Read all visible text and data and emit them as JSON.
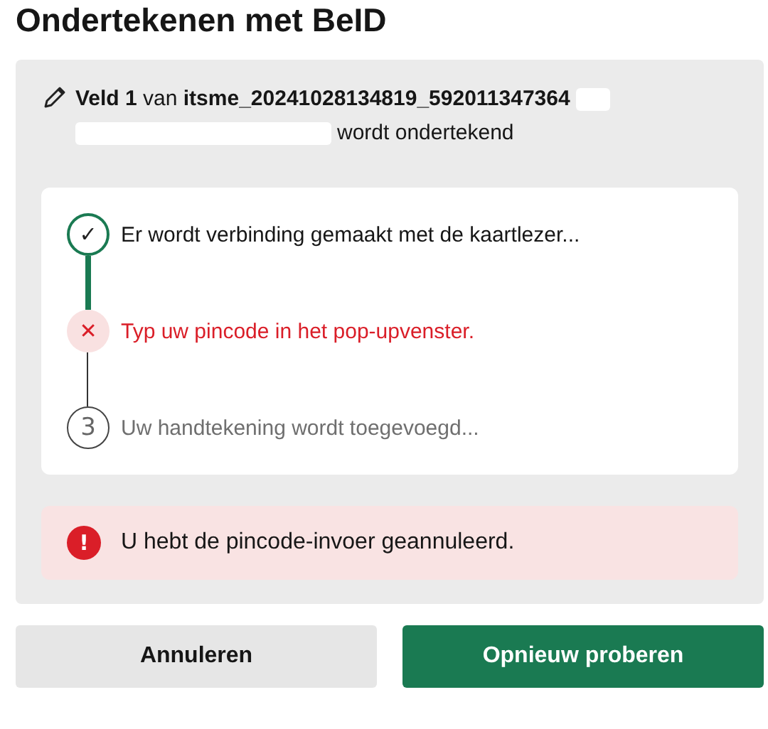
{
  "title": "Ondertekenen met BeID",
  "field": {
    "label": "**Veld 1** van **itsme_20241028134819_592011347364**",
    "suffix": "wordt ondertekend"
  },
  "steps": [
    {
      "kind": "done",
      "marker": "✓",
      "text": "Er wordt verbinding gemaakt met de kaartlezer..."
    },
    {
      "kind": "error",
      "marker": "✕",
      "text": "Typ uw pincode in het pop-upvenster."
    },
    {
      "kind": "pending",
      "marker": "3",
      "text": "Uw handtekening wordt toegevoegd..."
    }
  ],
  "alert": {
    "marker": "!",
    "text": "U hebt de pincode-invoer geannuleerd."
  },
  "buttons": [
    {
      "label": "Annuleren",
      "kind": "secondary"
    },
    {
      "label": "Opnieuw proberen",
      "kind": "primary"
    }
  ]
}
